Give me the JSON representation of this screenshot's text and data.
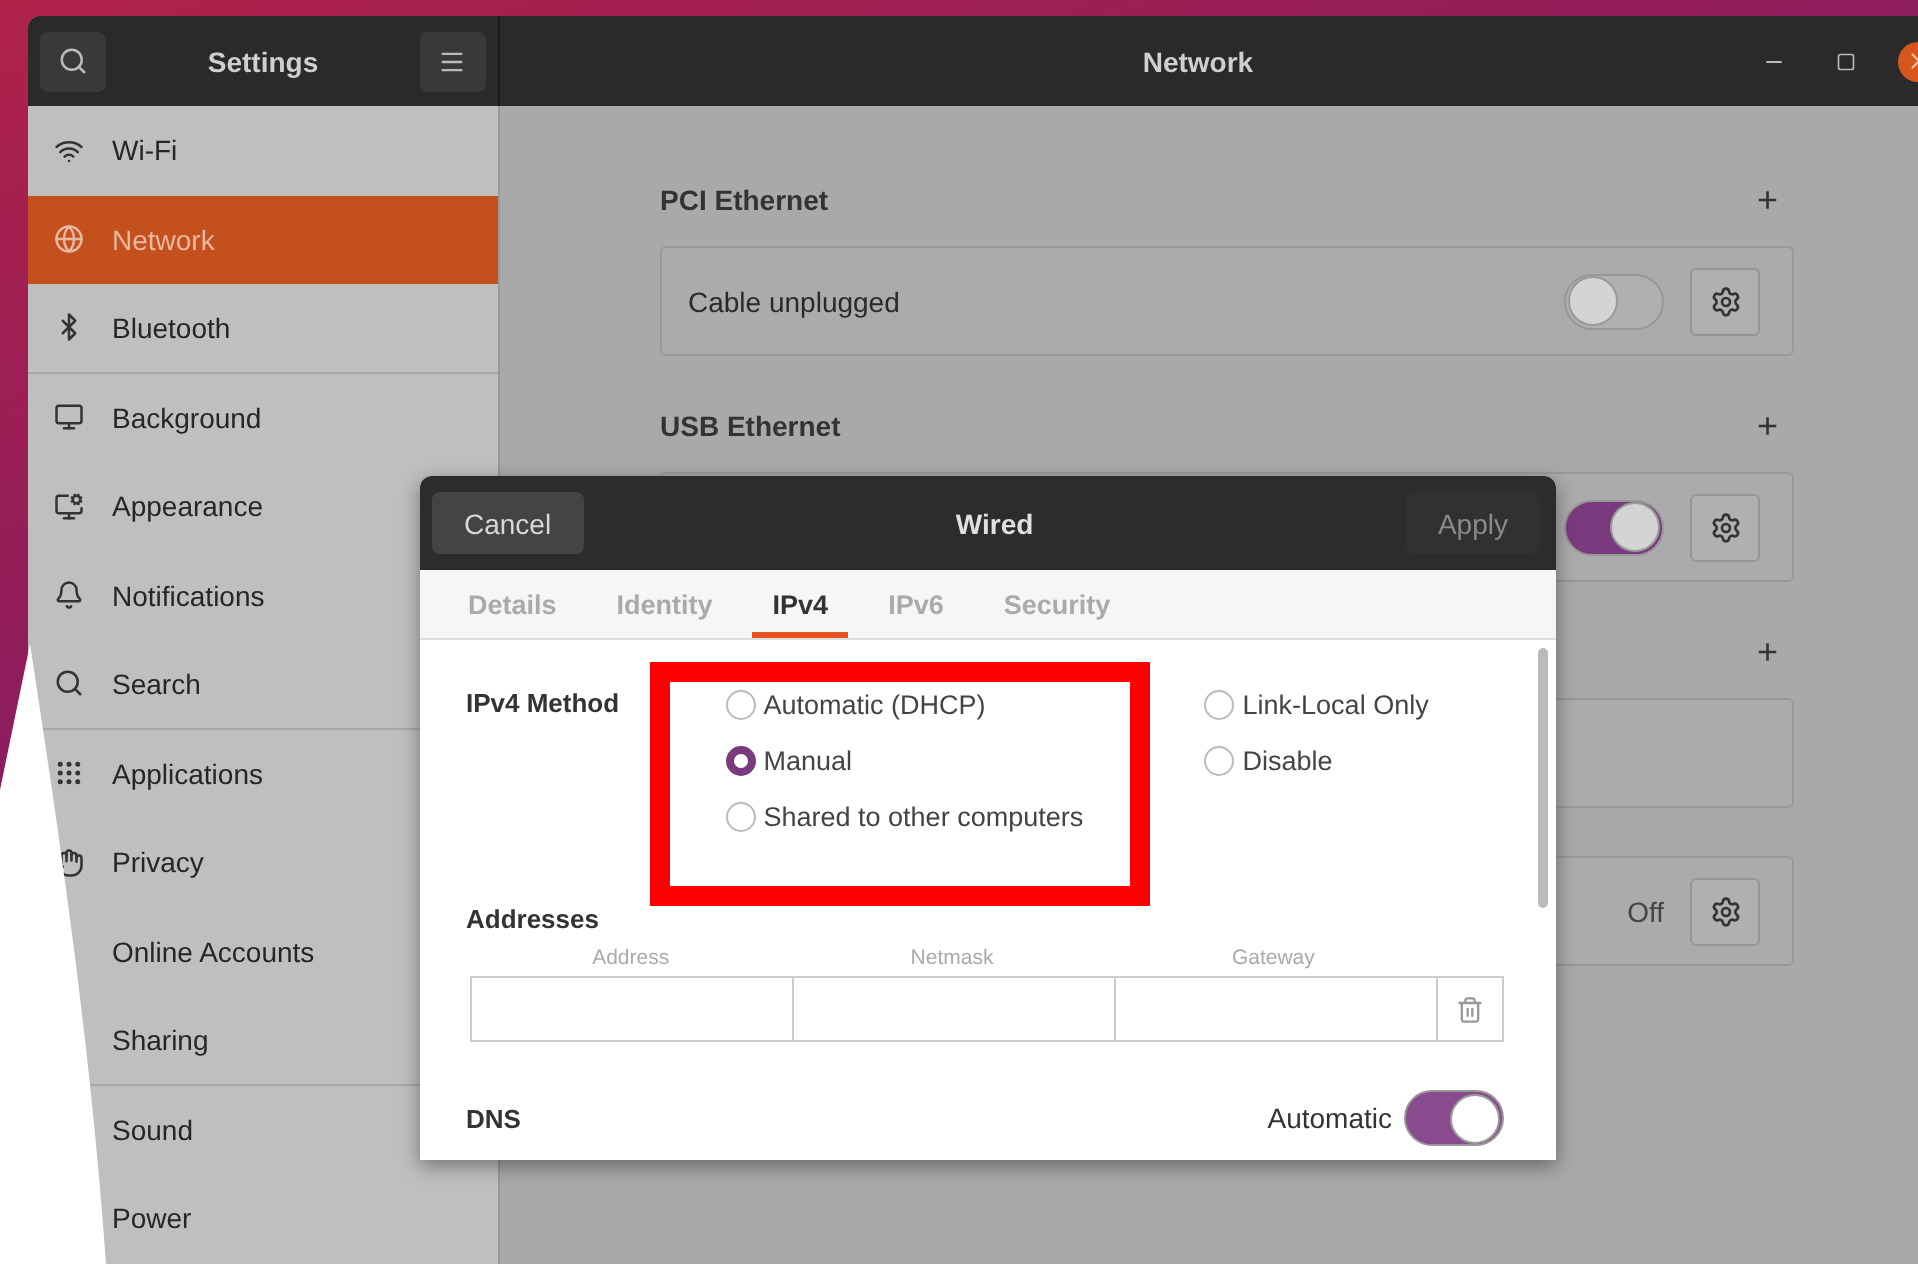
{
  "window": {
    "app_title": "Settings",
    "title": "Network"
  },
  "sidebar": {
    "items": [
      {
        "label": "Wi-Fi",
        "selected": false
      },
      {
        "label": "Network",
        "selected": true
      },
      {
        "label": "Bluetooth",
        "selected": false
      },
      {
        "label": "Background",
        "selected": false
      },
      {
        "label": "Appearance",
        "selected": false
      },
      {
        "label": "Notifications",
        "selected": false
      },
      {
        "label": "Search",
        "selected": false
      },
      {
        "label": "Applications",
        "selected": false
      },
      {
        "label": "Privacy",
        "selected": false
      },
      {
        "label": "Online Accounts",
        "selected": false
      },
      {
        "label": "Sharing",
        "selected": false
      },
      {
        "label": "Sound",
        "selected": false
      },
      {
        "label": "Power",
        "selected": false
      }
    ]
  },
  "sections": [
    {
      "title": "PCI Ethernet",
      "add": "+",
      "cards": [
        {
          "kind": "toggle",
          "label": "Cable unplugged",
          "on": false
        }
      ]
    },
    {
      "title": "USB Ethernet",
      "add": "+",
      "cards": [
        {
          "kind": "toggle",
          "on": true
        }
      ]
    },
    {
      "add": "+",
      "cards": [
        {
          "kind": "empty"
        }
      ]
    },
    {
      "cards": [
        {
          "kind": "status",
          "status": "Off"
        }
      ]
    }
  ],
  "dialog": {
    "cancel": "Cancel",
    "title": "Wired",
    "apply": "Apply",
    "tabs": [
      {
        "label": "Details",
        "selected": false
      },
      {
        "label": "Identity",
        "selected": false
      },
      {
        "label": "IPv4",
        "selected": true
      },
      {
        "label": "IPv6",
        "selected": false
      },
      {
        "label": "Security",
        "selected": false
      }
    ],
    "method_label": "IPv4 Method",
    "method_columns": [
      [
        {
          "label": "Automatic (DHCP)",
          "selected": false
        },
        {
          "label": "Manual",
          "selected": true
        },
        {
          "label": "Shared to other computers",
          "selected": false
        }
      ],
      [
        {
          "label": "Link-Local Only",
          "selected": false
        },
        {
          "label": "Disable",
          "selected": false
        }
      ]
    ],
    "addresses": {
      "title": "Addresses",
      "columns": [
        "Address",
        "Netmask",
        "Gateway"
      ]
    },
    "dns": {
      "title": "DNS",
      "label": "Automatic",
      "on": true
    }
  }
}
